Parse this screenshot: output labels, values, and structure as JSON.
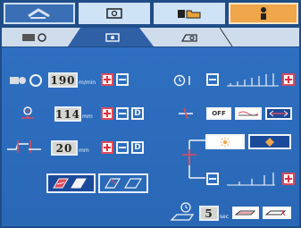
{
  "top_tabs": [
    {
      "name": "home-tab",
      "icon": "home-icon"
    },
    {
      "name": "screen-tab",
      "icon": "monitor-icon"
    },
    {
      "name": "folder-tab",
      "icon": "folder-icon"
    },
    {
      "name": "user-tab",
      "icon": "user-icon"
    }
  ],
  "sub_tabs": [
    {
      "name": "tab-counter",
      "icon": "counter-icon"
    },
    {
      "name": "tab-camera",
      "icon": "camera-icon"
    },
    {
      "name": "tab-settings",
      "icon": "settings-icon"
    }
  ],
  "speed": {
    "value": "190",
    "unit": "m/min"
  },
  "stitch": {
    "value": "114",
    "unit": "mm"
  },
  "offset": {
    "value": "20",
    "unit": "mm"
  },
  "toggle": {
    "off_label": "OFF"
  },
  "timer": {
    "value": "5",
    "unit": "sec"
  },
  "colors": {
    "accent": "#2c6dbd",
    "plus": "#e23040",
    "highlight": "#f0a64a"
  }
}
